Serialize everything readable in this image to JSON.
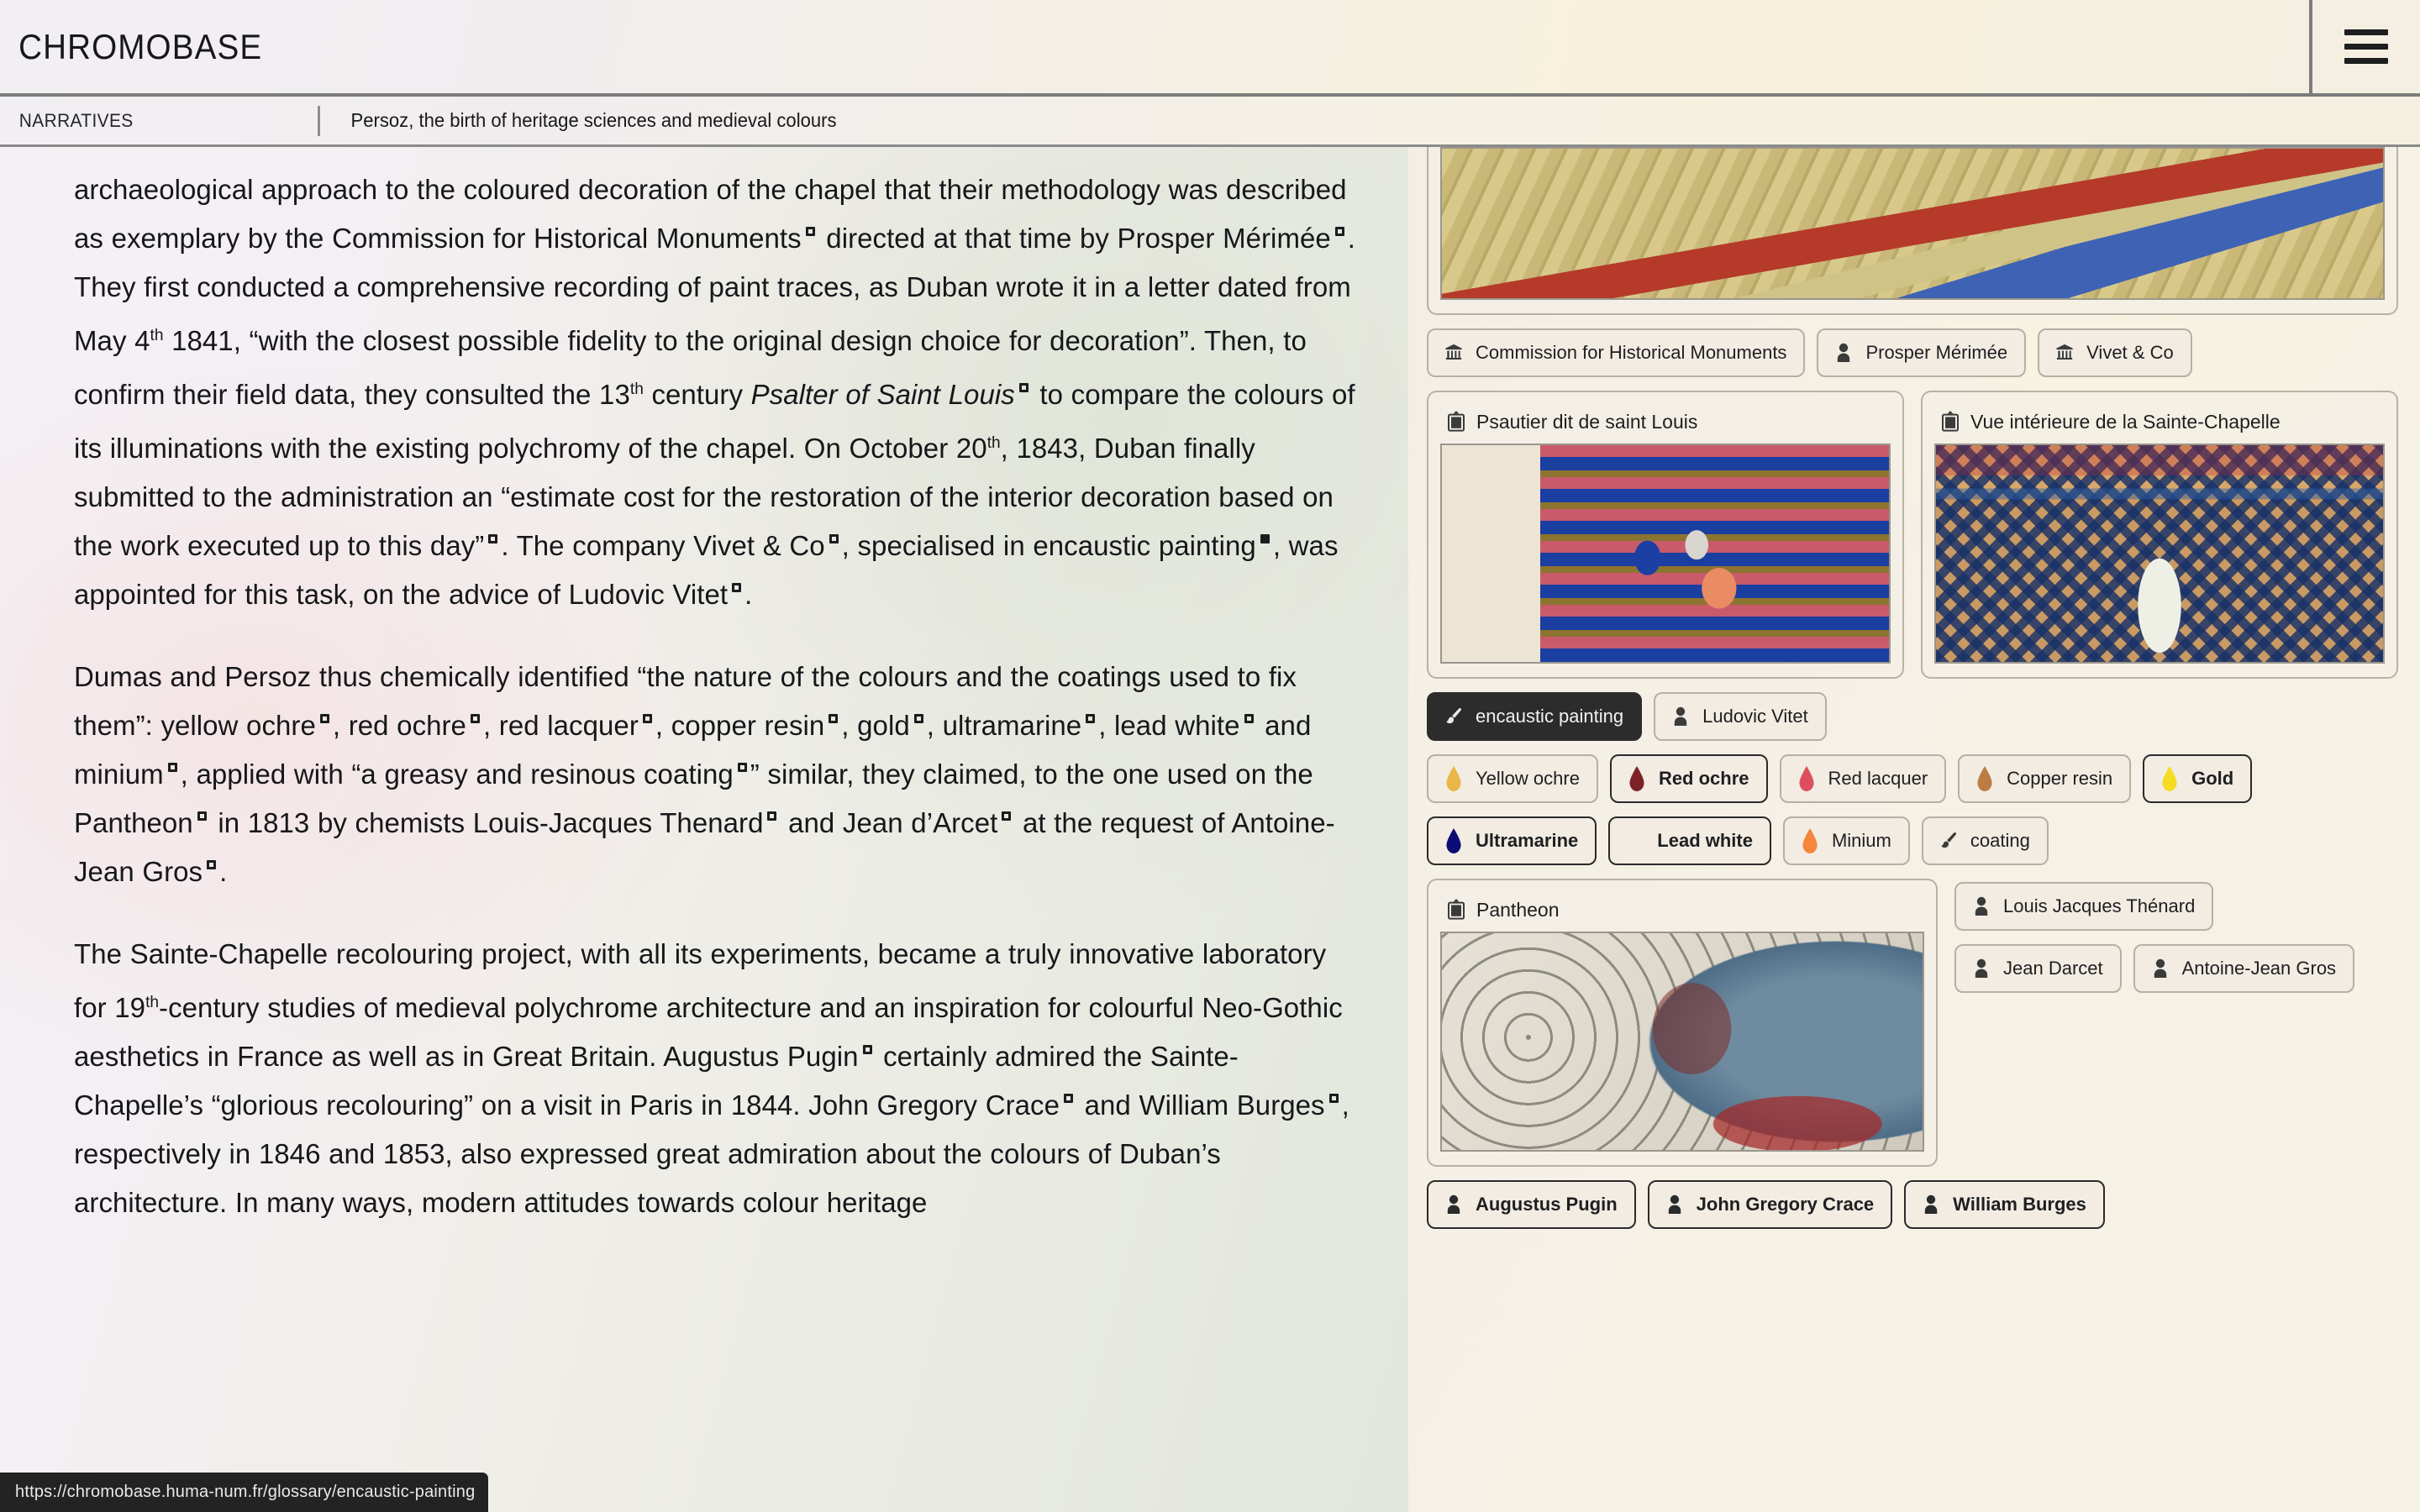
{
  "header": {
    "brand": "CHROMOBASE",
    "menu_icon": "hamburger-menu-icon"
  },
  "breadcrumb": {
    "section": "NARRATIVES",
    "title": "Persoz, the birth of heritage sciences and medieval colours"
  },
  "article": {
    "paragraph_1": {
      "t1": "archaeological approach to the coloured decoration of the chapel that their methodology was described as exemplary by the Commission for Historical Monuments",
      "t2": " directed at that time by Prosper Mérimée",
      "t3": ". They first conducted a comprehensive recording of paint traces, as Duban wrote it in a letter dated from May 4",
      "ord1": "th",
      "t4": " 1841, “with the closest possible fidelity to the original design choice for decoration”. Then, to confirm their field data, they consulted the 13",
      "ord2": "th",
      "t5": " century ",
      "italic1": "Psalter of Saint Louis",
      "t6": " to compare the colours of its illuminations with the existing polychromy of the chapel. On October 20",
      "ord3": "th",
      "t7": ", 1843, Duban finally submitted to the administration an “estimate cost for the restoration of the interior decoration based on the work executed up to this day”",
      "t8": ". The company Vivet & Co",
      "t9": ", specialised in encaustic painting",
      "t10": ", was appointed for this task, on the advice of Ludovic Vitet",
      "t11": "."
    },
    "paragraph_2": {
      "t1": "Dumas and Persoz thus chemically identified “the nature of the colours and the coatings used to fix them”: yellow ochre",
      "t2": ", red ochre",
      "t3": ", red lacquer",
      "t4": ", copper resin",
      "t5": ", gold",
      "t6": ", ultramarine",
      "t7": ", lead white",
      "t8": " and minium",
      "t9": ", applied with “a greasy and resinous coating",
      "t10": "” similar, they claimed, to the one used on the Pantheon",
      "t11": " in 1813 by chemists Louis-Jacques Thenard",
      "t12": " and Jean d’Arcet",
      "t13": " at the request of Antoine-Jean Gros",
      "t14": "."
    },
    "paragraph_3": {
      "t1": "The Sainte-Chapelle recolouring project, with all its experiments, became a truly innovative laboratory for 19",
      "ord1": "th",
      "t2": "-century studies of medieval polychrome architecture and an inspiration for colourful Neo-Gothic aesthetics in France as well as in Great Britain. Augustus Pugin",
      "t3": " certainly admired the Sainte-Chapelle’s “glorious recolouring” on a visit in Paris in 1844. John Gregory Crace",
      "t4": " and William Burges",
      "t5": ", respectively in 1846 and 1853, also expressed great admiration about the colours of Duban’s architecture. In many ways,",
      "t6": " modern attitudes towards colour heritage"
    }
  },
  "status_bar": {
    "url": "https://chromobase.huma-num.fr/glossary/encaustic-painting"
  },
  "side_panel": {
    "cards": {
      "arch": {
        "title": "",
        "image_alt": "medieval-polychrome-arch"
      },
      "psalter": {
        "title": "Psautier dit de saint Louis",
        "icon": "framed-picture-icon"
      },
      "chapelle": {
        "title": "Vue intérieure de la Sainte-Chapelle",
        "icon": "framed-picture-icon"
      },
      "pantheon": {
        "title": "Pantheon",
        "icon": "framed-picture-icon"
      }
    },
    "chips_row_1": [
      {
        "label": "Commission for Historical Monuments",
        "icon": "institution-icon",
        "state": "default"
      },
      {
        "label": "Prosper Mérimée",
        "icon": "person-icon",
        "state": "default"
      },
      {
        "label": "Vivet & Co",
        "icon": "institution-icon",
        "state": "default"
      }
    ],
    "chips_row_2": [
      {
        "label": "encaustic painting",
        "icon": "paintbrush-icon",
        "state": "filled"
      },
      {
        "label": "Ludovic Vitet",
        "icon": "person-icon",
        "state": "default"
      }
    ],
    "pigments_row_1": [
      {
        "label": "Yellow ochre",
        "icon": "paint-drop-icon",
        "color": "#e8b747",
        "state": "default"
      },
      {
        "label": "Red ochre",
        "icon": "paint-drop-icon",
        "color": "#7c2227",
        "state": "strong"
      },
      {
        "label": "Red lacquer",
        "icon": "paint-drop-icon",
        "color": "#dd4f60",
        "state": "default"
      },
      {
        "label": "Copper resin",
        "icon": "paint-drop-icon",
        "color": "#bc7c42",
        "state": "default"
      },
      {
        "label": "Gold",
        "icon": "paint-drop-icon",
        "color": "#f5dc23",
        "state": "strong"
      }
    ],
    "pigments_row_2": [
      {
        "label": "Ultramarine",
        "icon": "paint-drop-icon",
        "color": "#0d0b74",
        "state": "strong"
      },
      {
        "label": "Lead white",
        "icon": "paint-drop-icon",
        "color": "#f0ece5",
        "state": "strong"
      },
      {
        "label": "Minium",
        "icon": "paint-drop-icon",
        "color": "#f5863c",
        "state": "default"
      },
      {
        "label": "coating",
        "icon": "paintbrush-icon",
        "color": "#3b3b3c",
        "state": "default"
      }
    ],
    "chips_row_3": [
      {
        "label": "Louis Jacques Thénard",
        "icon": "person-icon",
        "state": "default"
      }
    ],
    "chips_row_4": [
      {
        "label": "Jean Darcet",
        "icon": "person-icon",
        "state": "default"
      },
      {
        "label": "Antoine-Jean Gros",
        "icon": "person-icon",
        "state": "default"
      }
    ],
    "chips_row_5": [
      {
        "label": "Augustus Pugin",
        "icon": "person-icon",
        "state": "strong"
      },
      {
        "label": "John Gregory Crace",
        "icon": "person-icon",
        "state": "strong"
      },
      {
        "label": "William Burges",
        "icon": "person-icon",
        "state": "strong"
      }
    ]
  }
}
